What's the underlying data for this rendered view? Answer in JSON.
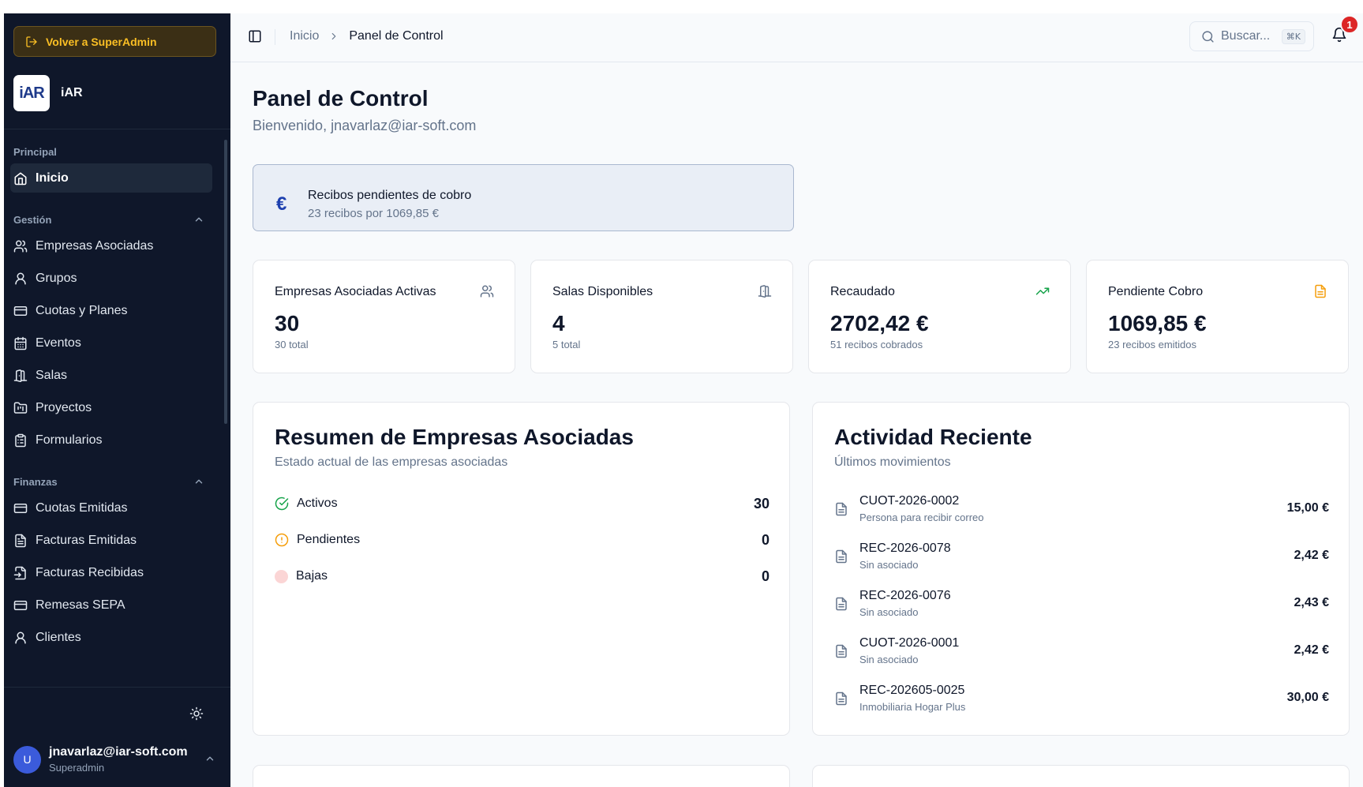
{
  "sidebar": {
    "back_button": "Volver a SuperAdmin",
    "brand_logo_text": "iAR",
    "brand_name": "iAR",
    "groups": [
      {
        "title": "Principal",
        "items": [
          {
            "label": "Inicio",
            "icon": "home-icon",
            "active": true
          }
        ]
      },
      {
        "title": "Gestión",
        "items": [
          {
            "label": "Empresas Asociadas",
            "icon": "users-icon"
          },
          {
            "label": "Grupos",
            "icon": "user-icon"
          },
          {
            "label": "Cuotas y Planes",
            "icon": "credit-card-icon"
          },
          {
            "label": "Eventos",
            "icon": "calendar-icon"
          },
          {
            "label": "Salas",
            "icon": "door-icon"
          },
          {
            "label": "Proyectos",
            "icon": "folder-chart-icon"
          },
          {
            "label": "Formularios",
            "icon": "clipboard-icon"
          }
        ]
      },
      {
        "title": "Finanzas",
        "items": [
          {
            "label": "Cuotas Emitidas",
            "icon": "credit-card-icon"
          },
          {
            "label": "Facturas Emitidas",
            "icon": "file-text-icon"
          },
          {
            "label": "Facturas Recibidas",
            "icon": "file-input-icon"
          },
          {
            "label": "Remesas SEPA",
            "icon": "credit-card-icon"
          },
          {
            "label": "Clientes",
            "icon": "user-icon"
          }
        ]
      }
    ],
    "user": {
      "initial": "U",
      "email": "jnavarlaz@iar-soft.com",
      "role": "Superadmin"
    }
  },
  "topbar": {
    "breadcrumb": {
      "home": "Inicio",
      "current": "Panel de Control"
    },
    "search_placeholder": "Buscar...",
    "search_shortcut": "⌘K",
    "notification_count": "1"
  },
  "page": {
    "title": "Panel de Control",
    "subtitle": "Bienvenido, jnavarlaz@iar-soft.com"
  },
  "alert": {
    "icon": "€",
    "title": "Recibos pendientes de cobro",
    "subtitle": "23 recibos por 1069,85 €"
  },
  "stats": [
    {
      "label": "Empresas Asociadas Activas",
      "value": "30",
      "note": "30 total",
      "icon": "users-icon",
      "icon_color": "#64748b"
    },
    {
      "label": "Salas Disponibles",
      "value": "4",
      "note": "5 total",
      "icon": "door-icon",
      "icon_color": "#64748b"
    },
    {
      "label": "Recaudado",
      "value": "2702,42 €",
      "note": "51 recibos cobrados",
      "icon": "trending-up-icon",
      "icon_color": "#16a34a"
    },
    {
      "label": "Pendiente Cobro",
      "value": "1069,85 €",
      "note": "23 recibos emitidos",
      "icon": "file-text-icon",
      "icon_color": "#f59e0b"
    }
  ],
  "summary": {
    "title": "Resumen de Empresas Asociadas",
    "subtitle": "Estado actual de las empresas asociadas",
    "rows": [
      {
        "label": "Activos",
        "value": "30",
        "icon": "check-circle-icon",
        "color": "#16a34a"
      },
      {
        "label": "Pendientes",
        "value": "0",
        "icon": "alert-circle-icon",
        "color": "#f59e0b"
      },
      {
        "label": "Bajas",
        "value": "0",
        "icon": "dot-icon",
        "color": "#fbd5d5"
      }
    ]
  },
  "activity": {
    "title": "Actividad Reciente",
    "subtitle": "Últimos movimientos",
    "rows": [
      {
        "code": "CUOT-2026-0002",
        "desc": "Persona para recibir correo",
        "amount": "15,00 €"
      },
      {
        "code": "REC-2026-0078",
        "desc": "Sin asociado",
        "amount": "2,42 €"
      },
      {
        "code": "REC-2026-0076",
        "desc": "Sin asociado",
        "amount": "2,43 €"
      },
      {
        "code": "CUOT-2026-0001",
        "desc": "Sin asociado",
        "amount": "2,42 €"
      },
      {
        "code": "REC-202605-0025",
        "desc": "Inmobiliaria Hogar Plus",
        "amount": "30,00 €"
      }
    ]
  }
}
